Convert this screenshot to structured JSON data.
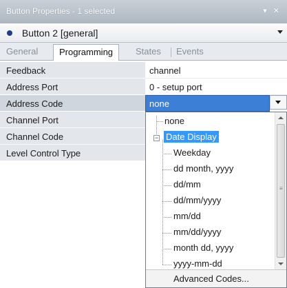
{
  "window": {
    "title": "Button Properties - 1 selected",
    "controls": "▾ ✕"
  },
  "selector": {
    "value": "Button 2 [general]"
  },
  "tabs": [
    {
      "label": "General"
    },
    {
      "label": "Programming"
    },
    {
      "label": "States"
    },
    {
      "label": "Events"
    }
  ],
  "properties": [
    {
      "name": "Feedback",
      "value": "channel"
    },
    {
      "name": "Address Port",
      "value": "0 - setup port"
    },
    {
      "name": "Address Code",
      "value": "none"
    },
    {
      "name": "Channel Port",
      "value": ""
    },
    {
      "name": "Channel Code",
      "value": ""
    },
    {
      "name": "Level Control Type",
      "value": ""
    }
  ],
  "dropdown": {
    "items": [
      {
        "label": "none"
      },
      {
        "label": "Date Display"
      },
      {
        "label": "Weekday"
      },
      {
        "label": "dd month, yyyy"
      },
      {
        "label": "dd/mm"
      },
      {
        "label": "dd/mm/yyyy"
      },
      {
        "label": "mm/dd"
      },
      {
        "label": "mm/dd/yyyy"
      },
      {
        "label": "month dd, yyyy"
      },
      {
        "label": "yyyy-mm-dd"
      }
    ],
    "expander_symbol": "−",
    "advanced_label": "Advanced Codes..."
  },
  "colors": {
    "selection": "#3c7fd6",
    "tree_highlight": "#3399ff"
  }
}
